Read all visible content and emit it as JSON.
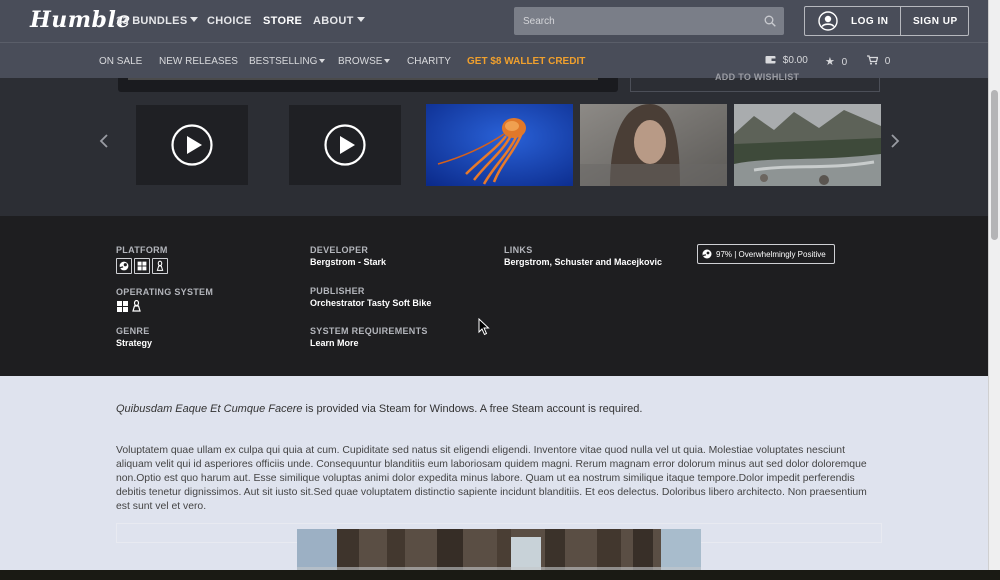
{
  "header": {
    "logo": "Humble",
    "nav": [
      {
        "label": "13 BUNDLES",
        "dropdown": true
      },
      {
        "label": "CHOICE",
        "dropdown": false
      },
      {
        "label": "STORE",
        "dropdown": false
      },
      {
        "label": "ABOUT",
        "dropdown": true
      }
    ],
    "search_placeholder": "Search",
    "login": "LOG IN",
    "signup": "SIGN UP"
  },
  "subnav": {
    "links": [
      {
        "label": "ON SALE"
      },
      {
        "label": "NEW RELEASES"
      },
      {
        "label": "BESTSELLING",
        "dropdown": true
      },
      {
        "label": "BROWSE",
        "dropdown": true
      },
      {
        "label": "CHARITY"
      },
      {
        "label": "GET $8 WALLET CREDIT",
        "accent": "#f0a02d"
      }
    ],
    "wallet": "$0.00",
    "wishlist_count": "0",
    "cart_count": "0"
  },
  "carousel": {
    "partial_button": "ADD TO WISHLIST",
    "thumbnails": [
      {
        "type": "video",
        "icon": "play-icon"
      },
      {
        "type": "video",
        "icon": "play-icon"
      },
      {
        "type": "image",
        "subject": "jellyfish"
      },
      {
        "type": "image",
        "subject": "woman-portrait"
      },
      {
        "type": "image",
        "subject": "mountain-river"
      }
    ]
  },
  "details": {
    "platform_label": "PLATFORM",
    "platform_icons": [
      "steam-icon",
      "windows-icon",
      "linux-icon"
    ],
    "os_label": "OPERATING SYSTEM",
    "os_icons": [
      "windows-icon",
      "linux-icon"
    ],
    "genre_label": "GENRE",
    "genre": "Strategy",
    "developer_label": "DEVELOPER",
    "developer": "Bergstrom - Stark",
    "publisher_label": "PUBLISHER",
    "publisher": "Orchestrator Tasty Soft Bike",
    "sysreq_label": "SYSTEM REQUIREMENTS",
    "sysreq_link": "Learn More",
    "links_label": "LINKS",
    "links_value": "Bergstrom, Schuster and Macejkovic",
    "rating": "97% | Overwhelmingly Positive"
  },
  "description": {
    "game_title": "Quibusdam Eaque Et Cumque Facere",
    "steam_note": " is provided via Steam for Windows. A free Steam account is required.",
    "body": "Voluptatem quae ullam ex culpa qui quia at cum. Cupiditate sed natus sit eligendi eligendi. Inventore vitae quod nulla vel ut quia. Molestiae voluptates nesciunt aliquam velit qui id asperiores officiis unde. Consequuntur blanditiis eum laboriosam quidem magni. Rerum magnam error dolorum minus aut sed dolor doloremque non.Optio est quo harum aut. Esse similique voluptas animi dolor expedita minus labore. Quam ut ea nostrum similique itaque tempore.Dolor impedit perferendis debitis tenetur dignissimos. Aut sit iusto sit.Sed quae voluptatem distinctio sapiente incidunt blanditiis. Et eos delectus. Doloribus libero architecto. Non praesentium est sunt vel et vero."
  },
  "colors": {
    "nav_bg": "#494d59",
    "accent": "#f0a02d",
    "info_bg": "#1e1e20",
    "desc_bg": "#dfe3ee"
  }
}
